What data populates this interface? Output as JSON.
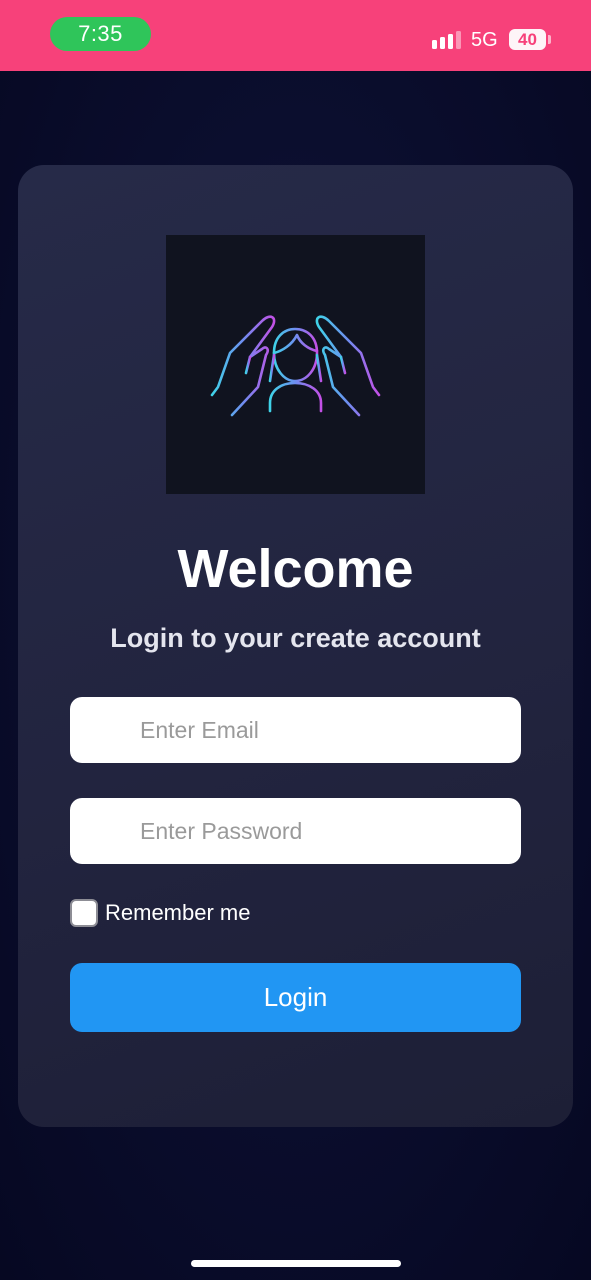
{
  "status_bar": {
    "time": "7:35",
    "network": "5G",
    "battery": "40",
    "background_color": "#f7417a"
  },
  "logo": {
    "icon": "protective-hands-person-icon",
    "background_color": "#10131f"
  },
  "login": {
    "title": "Welcome",
    "subtitle": "Login to your create account",
    "email_placeholder": "Enter Email",
    "email_value": "",
    "password_placeholder": "Enter Password",
    "password_value": "",
    "remember_label": "Remember me",
    "remember_checked": false,
    "button_label": "Login",
    "button_color": "#2196f3"
  }
}
